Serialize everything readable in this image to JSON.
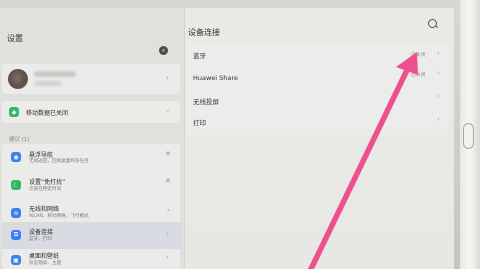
{
  "left_pane": {
    "title": "设置",
    "profile": {},
    "mobile_data": {
      "label": "移动数据已关闭"
    },
    "section_label": "建议 (1)",
    "items": [
      {
        "title": "悬浮导航",
        "subtitle": "无线返回，回到桌面和多任务"
      },
      {
        "title": "设置“免打扰”",
        "subtitle": "仅限在特定时间"
      },
      {
        "title": "无线和网络",
        "subtitle": "WLAN、移动网络、飞行模式"
      },
      {
        "title": "设备连接",
        "subtitle": "蓝牙、打印"
      },
      {
        "title": "桌面和壁纸",
        "subtitle": "杂志锁屏、主题"
      }
    ]
  },
  "right_pane": {
    "title": "设备连接",
    "items": [
      {
        "label": "蓝牙",
        "status": "已关闭"
      },
      {
        "label": "Huawei Share",
        "status": "已关闭"
      },
      {
        "label": "无线投屏",
        "status": ""
      },
      {
        "label": "打印",
        "status": ""
      }
    ]
  },
  "colors": {
    "annotation_arrow": "#ee4f8f",
    "green_icon": "#2fb867",
    "blue_icon": "#3b7ff0",
    "selected_row": "#d9dbe2"
  },
  "icons": [
    "search-icon",
    "chevron-right-icon",
    "close-icon",
    "navigation-icon",
    "moon-icon",
    "wifi-icon",
    "device-connection-icon",
    "wallpaper-icon",
    "mobile-data-icon"
  ]
}
